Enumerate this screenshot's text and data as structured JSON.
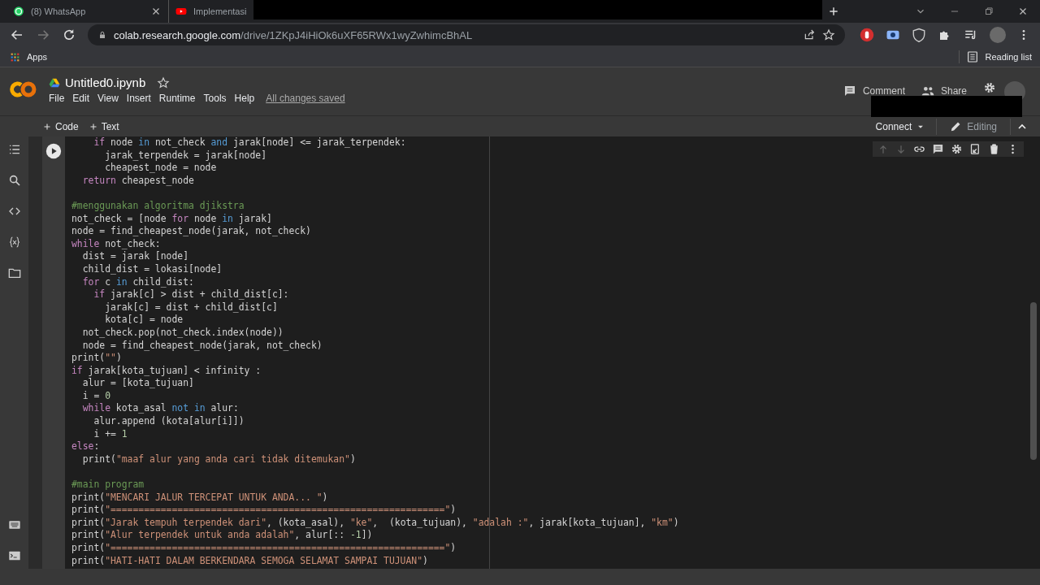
{
  "browser": {
    "tabs": [
      {
        "title": "(8) WhatsApp",
        "kind": "whatsapp"
      },
      {
        "title": "Implementasi",
        "kind": "video"
      }
    ],
    "url_host": "colab.research.google.com",
    "url_path": "/drive/1ZKpJ4iHiOk6uXF65RWx1wyZwhimcBhAL",
    "bookmarks": [
      "Apps"
    ],
    "reading_list": "Reading list"
  },
  "notebook": {
    "title": "Untitled0.ipynb",
    "menu": [
      "File",
      "Edit",
      "View",
      "Insert",
      "Runtime",
      "Tools",
      "Help"
    ],
    "save_status": "All changes saved",
    "header_actions": [
      {
        "label": "Comment",
        "kind": "comment"
      },
      {
        "label": "Share",
        "kind": "share"
      }
    ],
    "insert_buttons": [
      "Code",
      "Text"
    ],
    "connect": "Connect",
    "mode": "Editing"
  },
  "cell": {
    "lines": [
      {
        "kind": "code",
        "tokens": [
          {
            "kind": "keyword",
            "text": "    if"
          },
          {
            "kind": "plain",
            "text": " node "
          },
          {
            "kind": "operator",
            "text": "in"
          },
          {
            "kind": "plain",
            "text": " not_check "
          },
          {
            "kind": "operator",
            "text": "and"
          },
          {
            "kind": "plain",
            "text": " jarak[node] <= jarak_terpendek:"
          }
        ]
      },
      {
        "kind": "code",
        "tokens": [
          {
            "kind": "plain",
            "text": "      jarak_terpendek = jarak[node]"
          }
        ]
      },
      {
        "kind": "code",
        "tokens": [
          {
            "kind": "plain",
            "text": "      cheapest_node = node"
          }
        ]
      },
      {
        "kind": "code",
        "tokens": [
          {
            "kind": "keyword",
            "text": "  return"
          },
          {
            "kind": "plain",
            "text": " cheapest_node"
          }
        ]
      },
      {
        "kind": "blank"
      },
      {
        "kind": "code",
        "tokens": [
          {
            "kind": "comment",
            "text": "#menggunakan algoritma djikstra"
          }
        ]
      },
      {
        "kind": "code",
        "tokens": [
          {
            "kind": "plain",
            "text": "not_check = [node "
          },
          {
            "kind": "keyword",
            "text": "for"
          },
          {
            "kind": "plain",
            "text": " node "
          },
          {
            "kind": "operator",
            "text": "in"
          },
          {
            "kind": "plain",
            "text": " jarak]"
          }
        ]
      },
      {
        "kind": "code",
        "tokens": [
          {
            "kind": "plain",
            "text": "node = find_cheapest_node(jarak, not_check)"
          }
        ]
      },
      {
        "kind": "code",
        "tokens": [
          {
            "kind": "keyword",
            "text": "while"
          },
          {
            "kind": "plain",
            "text": " not_check:"
          }
        ]
      },
      {
        "kind": "code",
        "tokens": [
          {
            "kind": "plain",
            "text": "  dist = jarak [node]"
          }
        ]
      },
      {
        "kind": "code",
        "tokens": [
          {
            "kind": "plain",
            "text": "  child_dist = lokasi[node]"
          }
        ]
      },
      {
        "kind": "code",
        "tokens": [
          {
            "kind": "keyword",
            "text": "  for"
          },
          {
            "kind": "plain",
            "text": " c "
          },
          {
            "kind": "operator",
            "text": "in"
          },
          {
            "kind": "plain",
            "text": " child_dist:"
          }
        ]
      },
      {
        "kind": "code",
        "tokens": [
          {
            "kind": "keyword",
            "text": "    if"
          },
          {
            "kind": "plain",
            "text": " jarak[c] > dist + child_dist[c]:"
          }
        ]
      },
      {
        "kind": "code",
        "tokens": [
          {
            "kind": "plain",
            "text": "      jarak[c] = dist + child_dist[c]"
          }
        ]
      },
      {
        "kind": "code",
        "tokens": [
          {
            "kind": "plain",
            "text": "      kota[c] = node"
          }
        ]
      },
      {
        "kind": "code",
        "tokens": [
          {
            "kind": "plain",
            "text": "  not_check.pop(not_check.index(node))"
          }
        ]
      },
      {
        "kind": "code",
        "tokens": [
          {
            "kind": "plain",
            "text": "  node = find_cheapest_node(jarak, not_check)"
          }
        ]
      },
      {
        "kind": "code",
        "tokens": [
          {
            "kind": "plain",
            "text": "print("
          },
          {
            "kind": "string",
            "text": "\"\""
          },
          {
            "kind": "plain",
            "text": ")"
          }
        ]
      },
      {
        "kind": "code",
        "tokens": [
          {
            "kind": "keyword",
            "text": "if"
          },
          {
            "kind": "plain",
            "text": " jarak[kota_tujuan] < infinity :"
          }
        ]
      },
      {
        "kind": "code",
        "tokens": [
          {
            "kind": "plain",
            "text": "  alur = [kota_tujuan]"
          }
        ]
      },
      {
        "kind": "code",
        "tokens": [
          {
            "kind": "plain",
            "text": "  i = "
          },
          {
            "kind": "number",
            "text": "0"
          }
        ]
      },
      {
        "kind": "code",
        "tokens": [
          {
            "kind": "keyword",
            "text": "  while"
          },
          {
            "kind": "plain",
            "text": " kota_asal "
          },
          {
            "kind": "operator",
            "text": "not in"
          },
          {
            "kind": "plain",
            "text": " alur:"
          }
        ]
      },
      {
        "kind": "code",
        "tokens": [
          {
            "kind": "plain",
            "text": "    alur.append (kota[alur[i]])"
          }
        ]
      },
      {
        "kind": "code",
        "tokens": [
          {
            "kind": "plain",
            "text": "    i += "
          },
          {
            "kind": "number",
            "text": "1"
          }
        ]
      },
      {
        "kind": "code",
        "tokens": [
          {
            "kind": "keyword",
            "text": "else"
          },
          {
            "kind": "plain",
            "text": ":"
          }
        ]
      },
      {
        "kind": "code",
        "tokens": [
          {
            "kind": "plain",
            "text": "  print("
          },
          {
            "kind": "string",
            "text": "\"maaf alur yang anda cari tidak ditemukan\""
          },
          {
            "kind": "plain",
            "text": ")"
          }
        ]
      },
      {
        "kind": "blank"
      },
      {
        "kind": "code",
        "tokens": [
          {
            "kind": "comment",
            "text": "#main program"
          }
        ]
      },
      {
        "kind": "code",
        "tokens": [
          {
            "kind": "plain",
            "text": "print("
          },
          {
            "kind": "string",
            "text": "\"MENCARI JALUR TERCEPAT UNTUK ANDA... \""
          },
          {
            "kind": "plain",
            "text": ")"
          }
        ]
      },
      {
        "kind": "code",
        "tokens": [
          {
            "kind": "plain",
            "text": "print("
          },
          {
            "kind": "string",
            "text": "\"============================================================\""
          },
          {
            "kind": "plain",
            "text": ")"
          }
        ]
      },
      {
        "kind": "code",
        "tokens": [
          {
            "kind": "plain",
            "text": "print("
          },
          {
            "kind": "string",
            "text": "\"Jarak tempuh terpendek dari\""
          },
          {
            "kind": "plain",
            "text": ", (kota_asal), "
          },
          {
            "kind": "string",
            "text": "\"ke\""
          },
          {
            "kind": "plain",
            "text": ",  (kota_tujuan), "
          },
          {
            "kind": "string",
            "text": "\"adalah :\""
          },
          {
            "kind": "plain",
            "text": ", jarak[kota_tujuan], "
          },
          {
            "kind": "string",
            "text": "\"km\""
          },
          {
            "kind": "plain",
            "text": ")"
          }
        ]
      },
      {
        "kind": "code",
        "tokens": [
          {
            "kind": "plain",
            "text": "print("
          },
          {
            "kind": "string",
            "text": "\"Alur terpendek untuk anda adalah\""
          },
          {
            "kind": "plain",
            "text": ", alur[:: "
          },
          {
            "kind": "number",
            "text": "-1"
          },
          {
            "kind": "plain",
            "text": "])"
          }
        ]
      },
      {
        "kind": "code",
        "tokens": [
          {
            "kind": "plain",
            "text": "print("
          },
          {
            "kind": "string",
            "text": "\"============================================================\""
          },
          {
            "kind": "plain",
            "text": ")"
          }
        ]
      },
      {
        "kind": "code",
        "tokens": [
          {
            "kind": "plain",
            "text": "print("
          },
          {
            "kind": "string",
            "text": "\"HATI-HATI DALAM BERKENDARA SEMOGA SELAMAT SAMPAI TUJUAN\""
          },
          {
            "kind": "plain",
            "text": ")"
          }
        ]
      }
    ]
  }
}
